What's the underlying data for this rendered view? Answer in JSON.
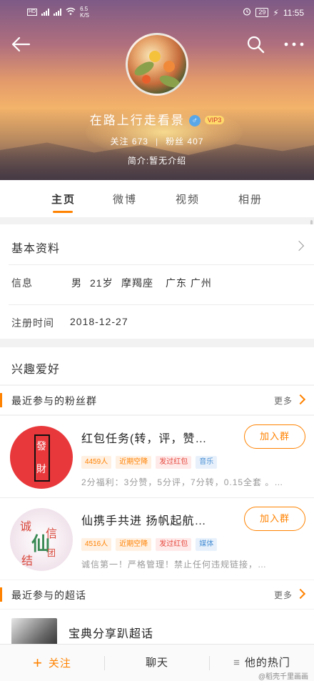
{
  "status_bar": {
    "net_speed": "6.5\nK/S",
    "net_speed_value": "6.5",
    "net_speed_unit": "K/S",
    "battery": "29",
    "time": "11:55"
  },
  "profile": {
    "name": "在路上行走看景",
    "gender_symbol": "♂",
    "vip_badge": "VIP3",
    "following_label": "关注",
    "following_count": "673",
    "followers_label": "粉丝",
    "followers_count": "407",
    "bio": "简介:暂无介绍"
  },
  "tabs": [
    {
      "label": "主页"
    },
    {
      "label": "微博"
    },
    {
      "label": "视频"
    },
    {
      "label": "相册"
    }
  ],
  "basic_info": {
    "title": "基本资料",
    "info_label": "信息",
    "info_values": [
      "男",
      "21岁",
      "摩羯座",
      "广东 广州"
    ],
    "register_label": "注册时间",
    "register_date": "2018-12-27"
  },
  "interests": {
    "title": "兴趣爱好"
  },
  "fan_groups": {
    "title": "最近参与的粉丝群",
    "more_label": "更多",
    "items": [
      {
        "name": "红包任务(转，评，赞…",
        "join_label": "加入群",
        "thumb_text_top": "發",
        "thumb_text_bottom": "財",
        "tags": [
          {
            "text": "4459人",
            "color": "orange"
          },
          {
            "text": "近期空降",
            "color": "orange"
          },
          {
            "text": "发过红包",
            "color": "red"
          },
          {
            "text": "音乐",
            "color": "blue"
          }
        ],
        "desc": "2分福利：3分赞，5分评，7分转，0.15全套 。…"
      },
      {
        "name": "仙携手共进 扬帆起航…",
        "join_label": "加入群",
        "thumb_text_1": "诚",
        "thumb_text_2": "信",
        "thumb_text_3": "结",
        "thumb_text_4": "团",
        "thumb_text_center": "仙",
        "tags": [
          {
            "text": "4516人",
            "color": "orange"
          },
          {
            "text": "近期空降",
            "color": "orange"
          },
          {
            "text": "发过红包",
            "color": "red"
          },
          {
            "text": "媒体",
            "color": "blue"
          }
        ],
        "desc": "诚信第一！严格管理！禁止任何违规链接，…"
      }
    ]
  },
  "super_topics": {
    "title": "最近参与的超话",
    "more_label": "更多",
    "items": [
      {
        "name": "宝典分享趴超话"
      }
    ]
  },
  "bottom_bar": {
    "follow_label": "关注",
    "follow_plus": "+",
    "chat_label": "聊天",
    "hot_label": "他的热门",
    "hot_icon": "≡"
  },
  "watermark": "@稻壳千里画画",
  "colors": {
    "accent": "#ff8200",
    "tag_red": "#e5483d",
    "tag_blue": "#4a8fd4"
  }
}
